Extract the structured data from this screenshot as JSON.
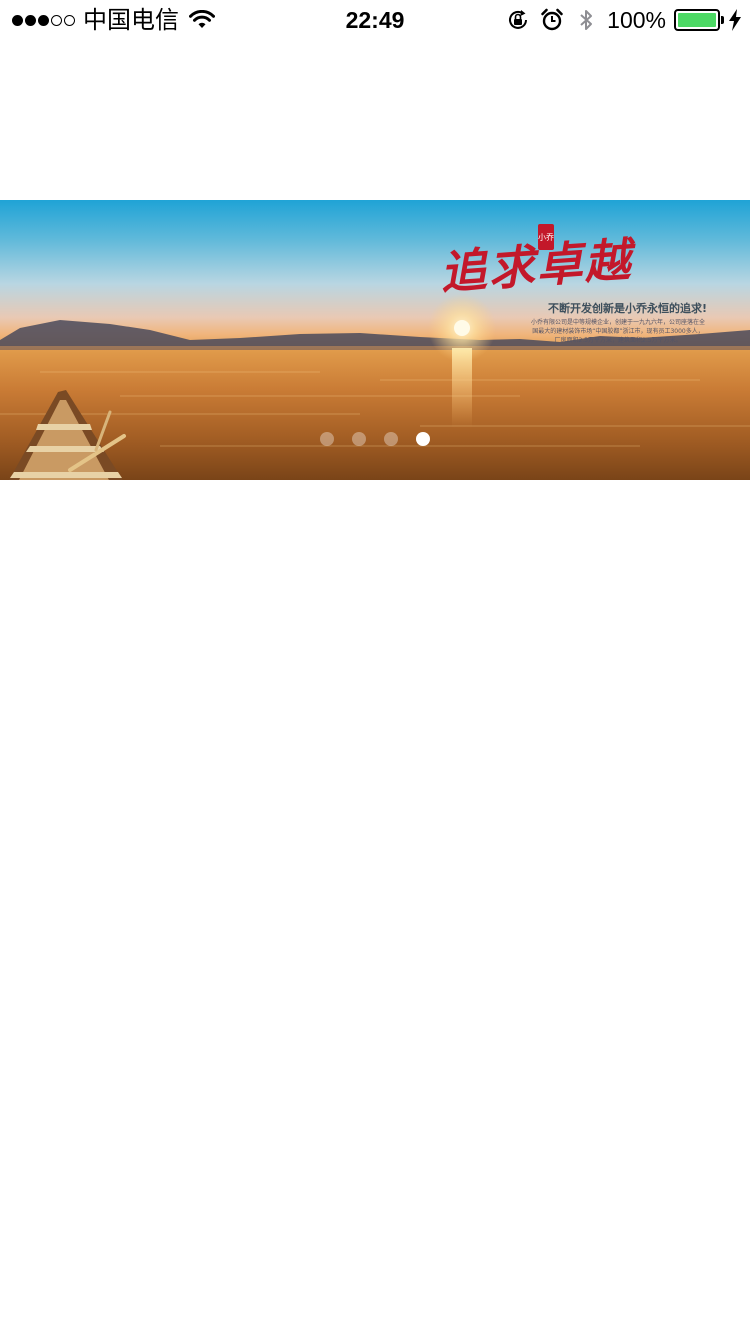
{
  "status_bar": {
    "signal_dots": [
      true,
      true,
      true,
      false,
      false
    ],
    "carrier": "中国电信",
    "time": "22:49",
    "battery_percent": "100%",
    "icons": [
      "wifi-icon",
      "rotation-lock-icon",
      "alarm-icon",
      "bluetooth-icon",
      "battery-icon",
      "charging-bolt-icon"
    ],
    "battery_color": "#4cd964"
  },
  "banner": {
    "slogan_title": "追求卓越",
    "slogan_seal": "小乔",
    "slogan_subtitle": "不断开发创新是小乔永恒的追求!",
    "slogan_small_text": "小乔有限公司是中等规模企业，创建于一九九六年，公司座落在全国最大的建材装饰市场“中国胶都”浙江市，现有员工3000多人，厂房面积2.5万平方米，建筑面积2.5万平方米。",
    "slides_total": 4,
    "active_slide": 4
  }
}
